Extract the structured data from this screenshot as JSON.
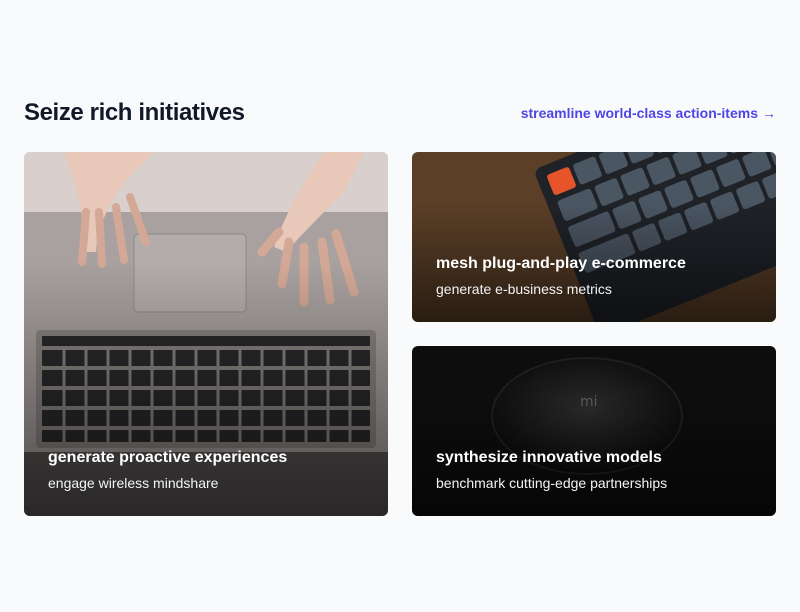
{
  "section": {
    "title": "Seize rich initiatives",
    "link_label": "streamline world-class action-items",
    "link_arrow": "→",
    "accent_color": "#4f46e5"
  },
  "cards": [
    {
      "title": "generate proactive experiences",
      "subtitle": "engage wireless mindshare",
      "image": "laptop-hands-photo"
    },
    {
      "title": "mesh plug-and-play e-commerce",
      "subtitle": "generate e-business metrics",
      "image": "keyboard-photo"
    },
    {
      "title": "synthesize innovative models",
      "subtitle": "benchmark cutting-edge partnerships",
      "image": "mouse-photo"
    }
  ]
}
